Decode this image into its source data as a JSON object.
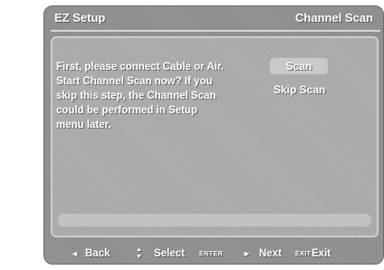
{
  "header": {
    "title": "EZ Setup",
    "section": "Channel Scan"
  },
  "message": {
    "lines": [
      "First, please connect Cable or Air.",
      "Start Channel Scan now? If you",
      "skip this step, the Channel Scan",
      "could be performed in Setup",
      "menu later."
    ]
  },
  "options": {
    "scan": "Scan",
    "skip_scan": "Skip Scan"
  },
  "footer": {
    "back_icon": "◄",
    "back_label": "Back",
    "select_icon": "▲▼",
    "select_label": "Select",
    "enter_key": "ENTER",
    "next_icon": "►",
    "next_label": "Next",
    "exit_key": "EXIT",
    "exit_label": "Exit"
  },
  "colors": {
    "frame": "#8f8f8f",
    "panel": "#ababab",
    "selected": "#c9c9c9",
    "text": "#ffffff"
  }
}
